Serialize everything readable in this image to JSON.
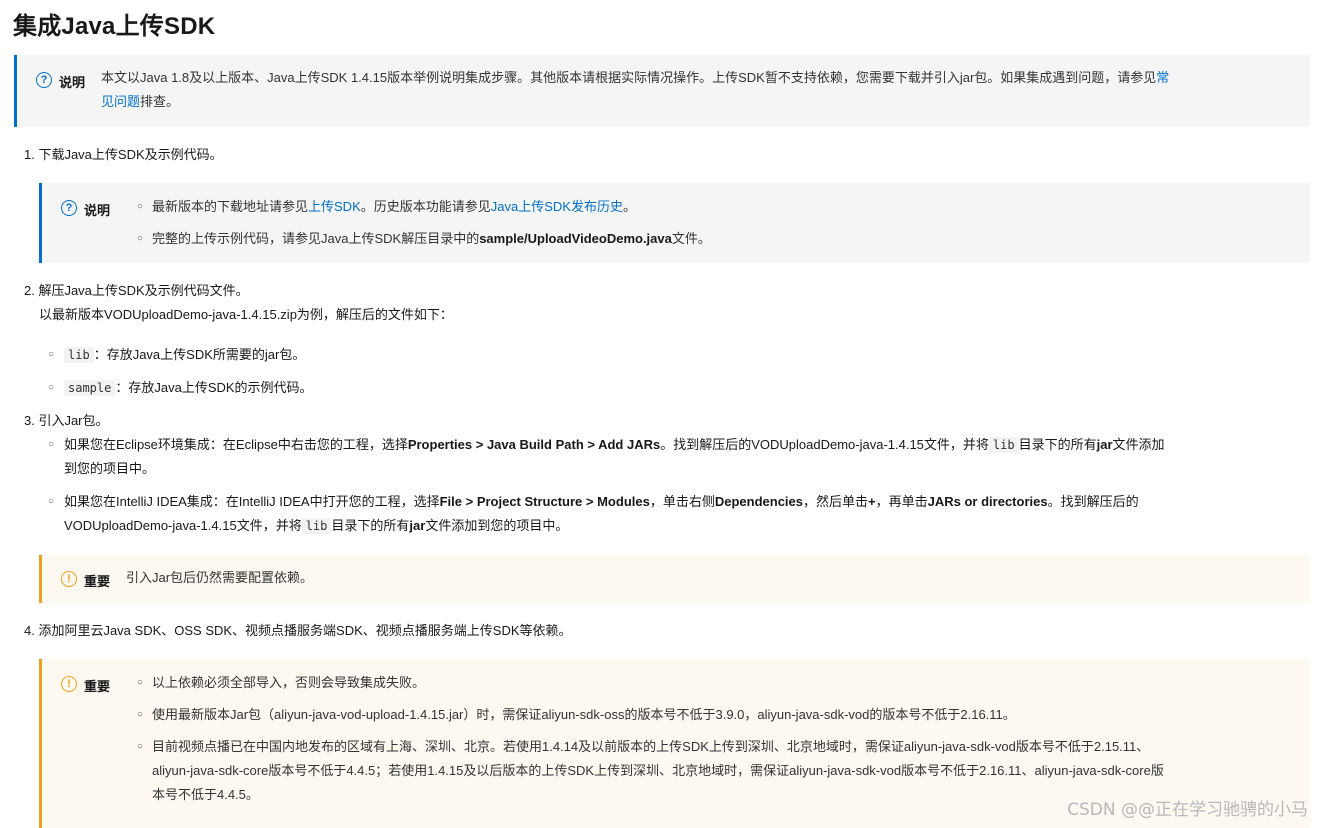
{
  "title": "集成Java上传SDK",
  "note_label": "说明",
  "important_label": "重要",
  "intro": {
    "text": "本文以Java 1.8及以上版本、Java上传SDK 1.4.15版本举例说明集成步骤。其他版本请根据实际情况操作。上传SDK暂不支持依赖，您需要下载并引入jar包。如果集成遇到问题，请参见",
    "link1": "常",
    "link2": "见问题",
    "tail": "排查。"
  },
  "step1": {
    "text": "1. 下载Java上传SDK及示例代码。",
    "note_item1_pre": "最新版本的下载地址请参见",
    "note_item1_link": "上传SDK",
    "note_item1_mid": "。历史版本功能请参见",
    "note_item1_link2": "Java上传SDK发布历史",
    "note_item1_end": "。",
    "note_item2_pre": "完整的上传示例代码，请参见Java上传SDK解压目录中的",
    "note_item2_bold": "sample/UploadVideoDemo.java",
    "note_item2_end": "文件。"
  },
  "step2": {
    "text": "2. 解压Java上传SDK及示例代码文件。",
    "desc": "以最新版本VODUploadDemo-java-1.4.15.zip为例，解压后的文件如下：",
    "item1_code": "lib",
    "item1_text": "：存放Java上传SDK所需要的jar包。",
    "item2_code": "sample",
    "item2_text": "：存放Java上传SDK的示例代码。"
  },
  "step3": {
    "text": "3. 引入Jar包。",
    "e_pre": "如果您在Eclipse环境集成：在Eclipse中右击您的工程，选择",
    "e_bold": "Properties > Java Build Path > Add JARs",
    "e_mid": "。找到解压后的VODUploadDemo-java-1.4.15文件，并将",
    "e_code": "lib",
    "e_mid2": "目录下的所有",
    "e_bold2": "jar",
    "e_end": "文件添加",
    "e_line2": "到您的项目中。",
    "i_pre": "如果您在IntelliJ IDEA集成：在IntelliJ IDEA中打开您的工程，选择",
    "i_bold": "File > Project Structure > Modules",
    "i_mid": "，单击右侧",
    "i_bold2": "Dependencies",
    "i_mid2": "，然后单击",
    "i_bold3": "+",
    "i_mid3": "，再单击",
    "i_bold4": "JARs or directories",
    "i_end": "。找到解压后的",
    "i_line2_pre": "VODUploadDemo-java-1.4.15文件，并将",
    "i_code": "lib",
    "i_line2_mid": "目录下的所有",
    "i_bold5": "jar",
    "i_line2_end": "文件添加到您的项目中。",
    "important": "引入Jar包后仍然需要配置依赖。"
  },
  "step4": {
    "text": "4. 添加阿里云Java SDK、OSS SDK、视频点播服务端SDK、视频点播服务端上传SDK等依赖。",
    "imp1": "以上依赖必须全部导入，否则会导致集成失败。",
    "imp2": "使用最新版本Jar包（aliyun-java-vod-upload-1.4.15.jar）时，需保证aliyun-sdk-oss的版本号不低于3.9.0，aliyun-java-sdk-vod的版本号不低于2.16.11。",
    "imp3_l1": "目前视频点播已在中国内地发布的区域有上海、深圳、北京。若使用1.4.14及以前版本的上传SDK上传到深圳、北京地域时，需保证aliyun-java-sdk-vod版本号不低于2.15.11、",
    "imp3_l2": "aliyun-java-sdk-core版本号不低于4.4.5；若使用1.4.15及以后版本的上传SDK上传到深圳、北京地域时，需保证aliyun-java-sdk-vod版本号不低于2.16.11、aliyun-java-sdk-core版",
    "imp3_l3": "本号不低于4.4.5。"
  },
  "watermark": "CSDN @@正在学习驰骋的小马",
  "colors": {
    "link": "#0070cc",
    "info_border": "#0070cc",
    "warn_border": "#f0a020"
  }
}
